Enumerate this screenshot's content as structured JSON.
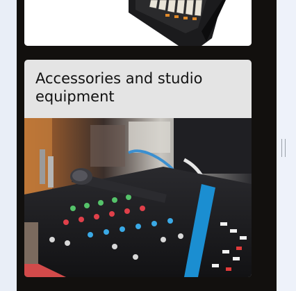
{
  "cards": [
    {
      "image_alt": "Synthesizer keyboard"
    },
    {
      "title": "Accessories and studio equipment",
      "image_alt": "Microphone lying on an audio mixing console"
    }
  ],
  "icons": {
    "resize": "vertical-resize-handle-icon"
  }
}
